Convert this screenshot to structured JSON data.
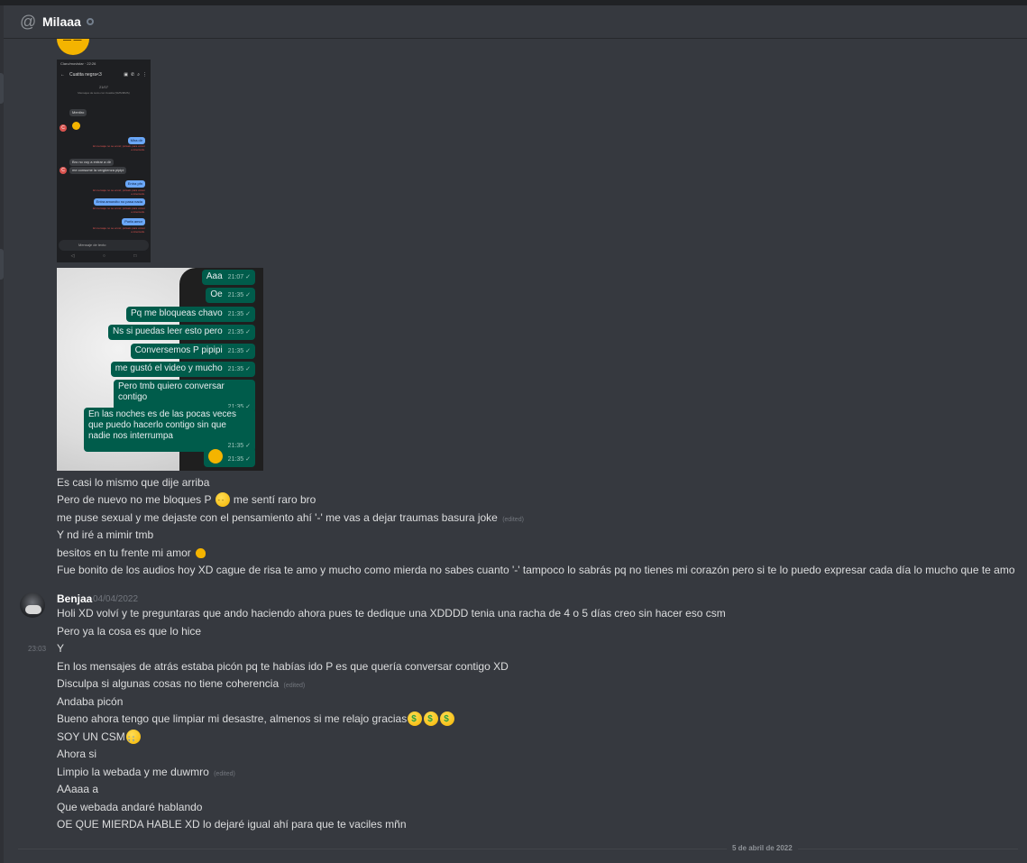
{
  "channel": {
    "at_symbol": "@",
    "name": "Milaaa"
  },
  "phone_screenshot": {
    "status_bar": "Claro/movistar · 22:26",
    "title": "Cuatita negra<3",
    "date": "21/07",
    "notice": "Mensajes de texto con Cuatita (SMS/MMS)",
    "messages": [
      {
        "from": "them",
        "text": "Mentiro"
      },
      {
        "from": "me",
        "text": "Mira dir"
      },
      {
        "from": "them",
        "text": "Bro no voy a entrar a dir"
      },
      {
        "from": "them",
        "text": "me consume la vergüenza pipipi"
      },
      {
        "from": "me",
        "text": "Entra pfn"
      },
      {
        "from": "me",
        "text": "Entra amorcito no pasa nada"
      },
      {
        "from": "me",
        "text": "Porfa amor"
      }
    ],
    "error_text": "El mensaje no se envió; púlsalo para volver a intentarlo.",
    "avatar_letter": "C",
    "input_placeholder": "Mensaje de texto"
  },
  "whatsapp_screenshot": {
    "bubbles": [
      {
        "text": "Aaa",
        "time": "21:07 ✓"
      },
      {
        "text": "Oe",
        "time": "21:35 ✓"
      },
      {
        "text": "Pq me bloqueas chavo",
        "time": "21:35 ✓"
      },
      {
        "text": "Ns si puedas leer esto pero",
        "time": "21:35 ✓"
      },
      {
        "text": "Conversemos P pipipi",
        "time": "21:35 ✓"
      },
      {
        "text": "me gustó el video y mucho",
        "time": "21:35 ✓"
      },
      {
        "text": "Pero tmb quiero conversar contigo",
        "time": "21:35 ✓"
      },
      {
        "text": "En las noches es de las pocas veces que puedo hacerlo contigo sin que nadie nos interrumpa",
        "time": "21:35 ✓"
      },
      {
        "text": "",
        "time": "21:35 ✓"
      }
    ]
  },
  "first_messages": [
    {
      "text": "Es casi lo mismo que dije arriba"
    },
    {
      "text_a": "Pero de nuevo no me bloques P",
      "text_b": "me sentí raro bro"
    },
    {
      "text": "me puse sexual y me dejaste con el pensamiento ahí '-' me vas a dejar traumas basura joke",
      "edited": "(edited)"
    },
    {
      "text": "Y nd iré a mimir tmb"
    },
    {
      "text": "besitos en tu frente mi amor"
    },
    {
      "text": "Fue bonito de los audios hoy XD cague de risa te amo y mucho como mierda no sabes cuanto '-' tampoco lo sabrás pq no tienes mi corazón pero si te lo puedo expresar cada día lo mucho que te amo"
    }
  ],
  "second_group": {
    "username": "Benjaa",
    "date": "04/04/2022",
    "hover_time": "23:03",
    "messages": [
      {
        "text": "Holi XD volví y te preguntaras que ando haciendo ahora pues te dedique una XDDDD tenia una racha de 4 o 5 días creo sin hacer eso csm"
      },
      {
        "text": "Pero ya la cosa es que lo hice"
      },
      {
        "text": "Y"
      },
      {
        "text": "En los mensajes de atrás estaba picón pq te habías ido P es que quería conversar contigo XD"
      },
      {
        "text": "Disculpa si algunas cosas no tiene coherencia",
        "edited": "(edited)"
      },
      {
        "text": "Andaba picón"
      },
      {
        "text": "Bueno ahora tengo que limpiar mi desastre, almenos si me relajo gracias"
      },
      {
        "text": "SOY UN CSM"
      },
      {
        "text": "Ahora si"
      },
      {
        "text": "Limpio la webada y me duwmro",
        "edited": "(edited)"
      },
      {
        "text": "AAaaa a"
      },
      {
        "text": "Que webada andaré hablando"
      },
      {
        "text": "OE QUE MIERDA HABLE XD lo dejaré igual ahí para que te vaciles mñn"
      }
    ]
  },
  "date_divider": "5 de abril de 2022"
}
